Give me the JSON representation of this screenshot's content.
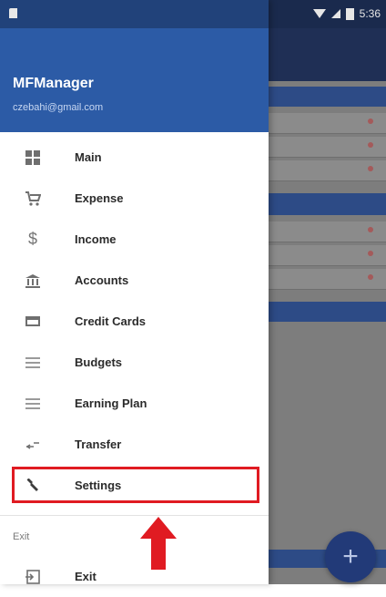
{
  "status_bar": {
    "time": "5:36"
  },
  "drawer": {
    "app_name": "MFManager",
    "email": "czebahi@gmail.com",
    "items": [
      {
        "label": "Main",
        "icon": "dashboard-icon"
      },
      {
        "label": "Expense",
        "icon": "cart-icon"
      },
      {
        "label": "Income",
        "icon": "dollar-icon"
      },
      {
        "label": "Accounts",
        "icon": "bank-icon"
      },
      {
        "label": "Credit Cards",
        "icon": "credit-card-icon"
      },
      {
        "label": "Budgets",
        "icon": "list-icon"
      },
      {
        "label": "Earning Plan",
        "icon": "list-icon"
      },
      {
        "label": "Transfer",
        "icon": "transfer-icon"
      },
      {
        "label": "Settings",
        "icon": "wrench-icon",
        "highlighted": true
      }
    ],
    "section_label": "Exit",
    "exit_item": {
      "label": "Exit",
      "icon": "exit-icon"
    }
  },
  "fab": {
    "label": "+"
  },
  "annotation": {
    "color": "#e01b22"
  },
  "colors": {
    "header": "#2c5ba6",
    "status": "#21427a",
    "accent": "#e01b22"
  }
}
